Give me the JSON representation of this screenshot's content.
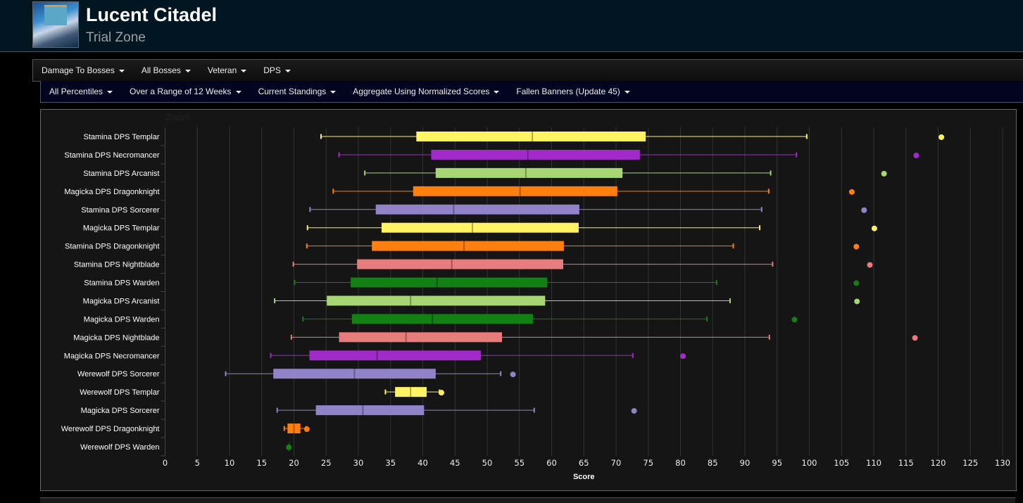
{
  "header": {
    "title": "Lucent Citadel",
    "subtitle": "Trial Zone"
  },
  "filters_primary": [
    "Damage To Bosses",
    "All Bosses",
    "Veteran",
    "DPS"
  ],
  "filters_secondary": [
    "All Percentiles",
    "Over a Range of 12 Weeks",
    "Current Standings",
    "Aggregate Using Normalized Scores",
    "Fallen Banners (Update 45)"
  ],
  "chart_data": {
    "type": "boxplot",
    "orientation": "horizontal",
    "zoom_label": "Zoom",
    "xlabel": "Score",
    "xlim": [
      0,
      130
    ],
    "xticks": [
      0,
      5,
      10,
      15,
      20,
      25,
      30,
      35,
      40,
      45,
      50,
      55,
      60,
      65,
      70,
      75,
      80,
      85,
      90,
      95,
      100,
      105,
      110,
      115,
      120,
      125,
      130
    ],
    "grid": true,
    "series": [
      {
        "name": "Stamina DPS Templar",
        "color": "#fff263",
        "min": 24.2,
        "q1": 39.0,
        "median": 57.0,
        "q3": 74.6,
        "max": 99.6,
        "outlier": 120.5
      },
      {
        "name": "Stamina DPS Necromancer",
        "color": "#a02bc9",
        "min": 27.0,
        "q1": 41.3,
        "median": 56.3,
        "q3": 73.7,
        "max": 98.0,
        "outlier": 116.6
      },
      {
        "name": "Stamina DPS Arcanist",
        "color": "#a8d672",
        "min": 31.0,
        "q1": 42.0,
        "median": 56.0,
        "q3": 71.0,
        "max": 94.0,
        "outlier": 111.6
      },
      {
        "name": "Magicka DPS Dragonknight",
        "color": "#ff7f0e",
        "min": 26.1,
        "q1": 38.5,
        "median": 55.1,
        "q3": 70.2,
        "max": 93.7,
        "outlier": 106.6
      },
      {
        "name": "Stamina DPS Sorcerer",
        "color": "#9283c8",
        "min": 22.5,
        "q1": 32.7,
        "median": 44.8,
        "q3": 64.3,
        "max": 92.6,
        "outlier": 108.5
      },
      {
        "name": "Magicka DPS Templar",
        "color": "#fff263",
        "min": 22.1,
        "q1": 33.6,
        "median": 47.7,
        "q3": 64.2,
        "max": 92.3,
        "outlier": 110.1
      },
      {
        "name": "Stamina DPS Dragonknight",
        "color": "#ff7f0e",
        "min": 22.0,
        "q1": 32.1,
        "median": 46.4,
        "q3": 61.9,
        "max": 88.2,
        "outlier": 107.3
      },
      {
        "name": "Stamina DPS Nightblade",
        "color": "#e87b7b",
        "min": 19.9,
        "q1": 29.8,
        "median": 44.5,
        "q3": 61.8,
        "max": 94.3,
        "outlier": 109.4
      },
      {
        "name": "Stamina DPS Warden",
        "color": "#138013",
        "min": 20.1,
        "q1": 28.8,
        "median": 42.2,
        "q3": 59.3,
        "max": 85.6,
        "outlier": 107.3
      },
      {
        "name": "Magicka DPS Arcanist",
        "color": "#a8d672",
        "min": 17.0,
        "q1": 25.1,
        "median": 38.1,
        "q3": 59.0,
        "max": 87.7,
        "outlier": 107.4
      },
      {
        "name": "Magicka DPS Warden",
        "color": "#138013",
        "min": 21.4,
        "q1": 29.0,
        "median": 41.5,
        "q3": 57.1,
        "max": 84.1,
        "outlier": 97.7
      },
      {
        "name": "Magicka DPS Nightblade",
        "color": "#e87b7b",
        "min": 19.6,
        "q1": 27.0,
        "median": 37.4,
        "q3": 52.3,
        "max": 93.8,
        "outlier": 116.4
      },
      {
        "name": "Magicka DPS Necromancer",
        "color": "#a02bc9",
        "min": 16.4,
        "q1": 22.4,
        "median": 32.9,
        "q3": 49.0,
        "max": 72.6,
        "outlier": 80.4
      },
      {
        "name": "Werewolf DPS Sorcerer",
        "color": "#9283c8",
        "min": 9.4,
        "q1": 16.8,
        "median": 29.4,
        "q3": 42.0,
        "max": 52.1,
        "outlier": 54.0
      },
      {
        "name": "Werewolf DPS Templar",
        "color": "#fff263",
        "min": 34.2,
        "q1": 35.7,
        "median": 38.1,
        "q3": 40.6,
        "max": 42.6,
        "outlier": 42.9
      },
      {
        "name": "Magicka DPS Sorcerer",
        "color": "#9283c8",
        "min": 17.4,
        "q1": 23.4,
        "median": 30.7,
        "q3": 40.2,
        "max": 57.3,
        "outlier": 72.8
      },
      {
        "name": "Werewolf DPS Dragonknight",
        "color": "#ff7f0e",
        "min": 18.5,
        "q1": 19.0,
        "median": 20.0,
        "q3": 21.0,
        "max": 21.9,
        "outlier": 22.0
      },
      {
        "name": "Werewolf DPS Warden",
        "color": "#138013",
        "min": 19.2,
        "q1": 19.2,
        "median": 19.2,
        "q3": 19.2,
        "max": 19.3,
        "outlier": 19.2
      }
    ]
  }
}
